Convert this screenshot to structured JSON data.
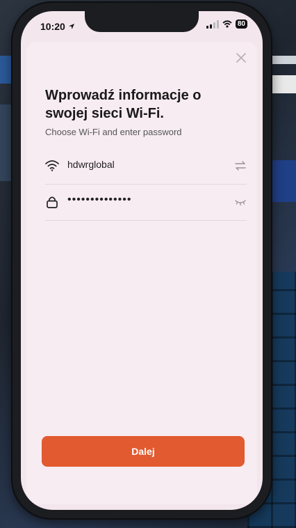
{
  "status_bar": {
    "time": "10:20",
    "battery": "80"
  },
  "dialog": {
    "title": "Wprowadź informacje o swojej sieci Wi-Fi.",
    "subtitle": "Choose Wi-Fi and enter password",
    "wifi_name": "hdwrglobal",
    "password_masked": "••••••••••••••",
    "next_label": "Dalej"
  },
  "colors": {
    "accent": "#e25a30",
    "sheet_bg": "#f7ecf1"
  },
  "icons": {
    "close": "close-icon",
    "wifi": "wifi-icon",
    "switch": "switch-network-icon",
    "lock": "lock-icon",
    "eye": "eye-closed-icon"
  }
}
